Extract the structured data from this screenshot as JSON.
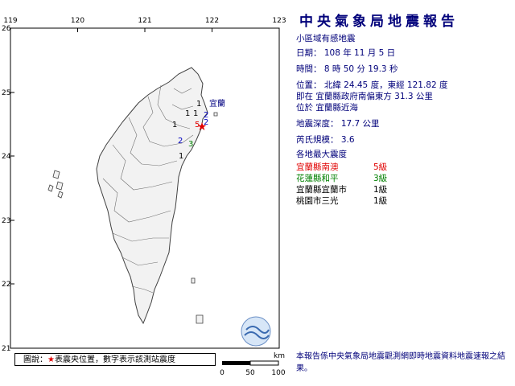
{
  "map": {
    "lon_ticks": [
      "119",
      "120",
      "121",
      "122",
      "123"
    ],
    "lat_ticks": [
      "26",
      "25",
      "24",
      "23",
      "22",
      "21"
    ],
    "scale_unit": "km",
    "scale_labels": [
      "0",
      "50",
      "100"
    ],
    "station_numbers": [
      {
        "text": "1",
        "color": "#000000"
      },
      {
        "text": "宜蘭",
        "color": "#000080"
      },
      {
        "text": "2",
        "color": "#0000c0"
      },
      {
        "text": "1",
        "color": "#000000"
      },
      {
        "text": "1",
        "color": "#000000"
      },
      {
        "text": "2",
        "color": "#0000c0"
      },
      {
        "text": "1",
        "color": "#000000"
      },
      {
        "text": "5",
        "color": "#e00000"
      },
      {
        "text": "2",
        "color": "#0000c0"
      },
      {
        "text": "3",
        "color": "#008000"
      },
      {
        "text": "1",
        "color": "#000000"
      }
    ],
    "epicenter_icon": "red-star-icon",
    "logo_icon": "cwb-logo-icon",
    "colors": {
      "land": "#f2f2f2",
      "sea": "#ffffff",
      "coast": "#404040",
      "county": "#606060",
      "epicenter": "#e00000"
    }
  },
  "legend": {
    "prefix": "圖說：",
    "star": "★",
    "text": "表震央位置，數字表示該測站震度"
  },
  "report": {
    "title": "中央氣象局地震報告",
    "subtitle": "小區域有感地震",
    "date": "日期： 108 年 11 月 5 日",
    "time": "時間： 8 時 50 分 19.3 秒",
    "position": "位置： 北緯 24.45 度，東經 121.82 度",
    "position_detail": "即在 宜蘭縣政府南偏東方 31.3 公里",
    "located_at": "位於 宜蘭縣近海",
    "depth": "地震深度： 17.7 公里",
    "magnitude": "芮氏規模： 3.6",
    "max_intensity_header": "各地最大震度",
    "intensities": [
      {
        "location": "宜蘭縣南澳",
        "level": "5級",
        "color": "#e00000"
      },
      {
        "location": "花蓮縣和平",
        "level": "3級",
        "color": "#008000"
      },
      {
        "location": "宜蘭縣宜蘭市",
        "level": "1級",
        "color": "#000000"
      },
      {
        "location": "桃園市三光",
        "level": "1級",
        "color": "#000000"
      }
    ],
    "footer": "本報告係中央氣象局地震觀測網即時地震資料地震速報之結果。"
  }
}
